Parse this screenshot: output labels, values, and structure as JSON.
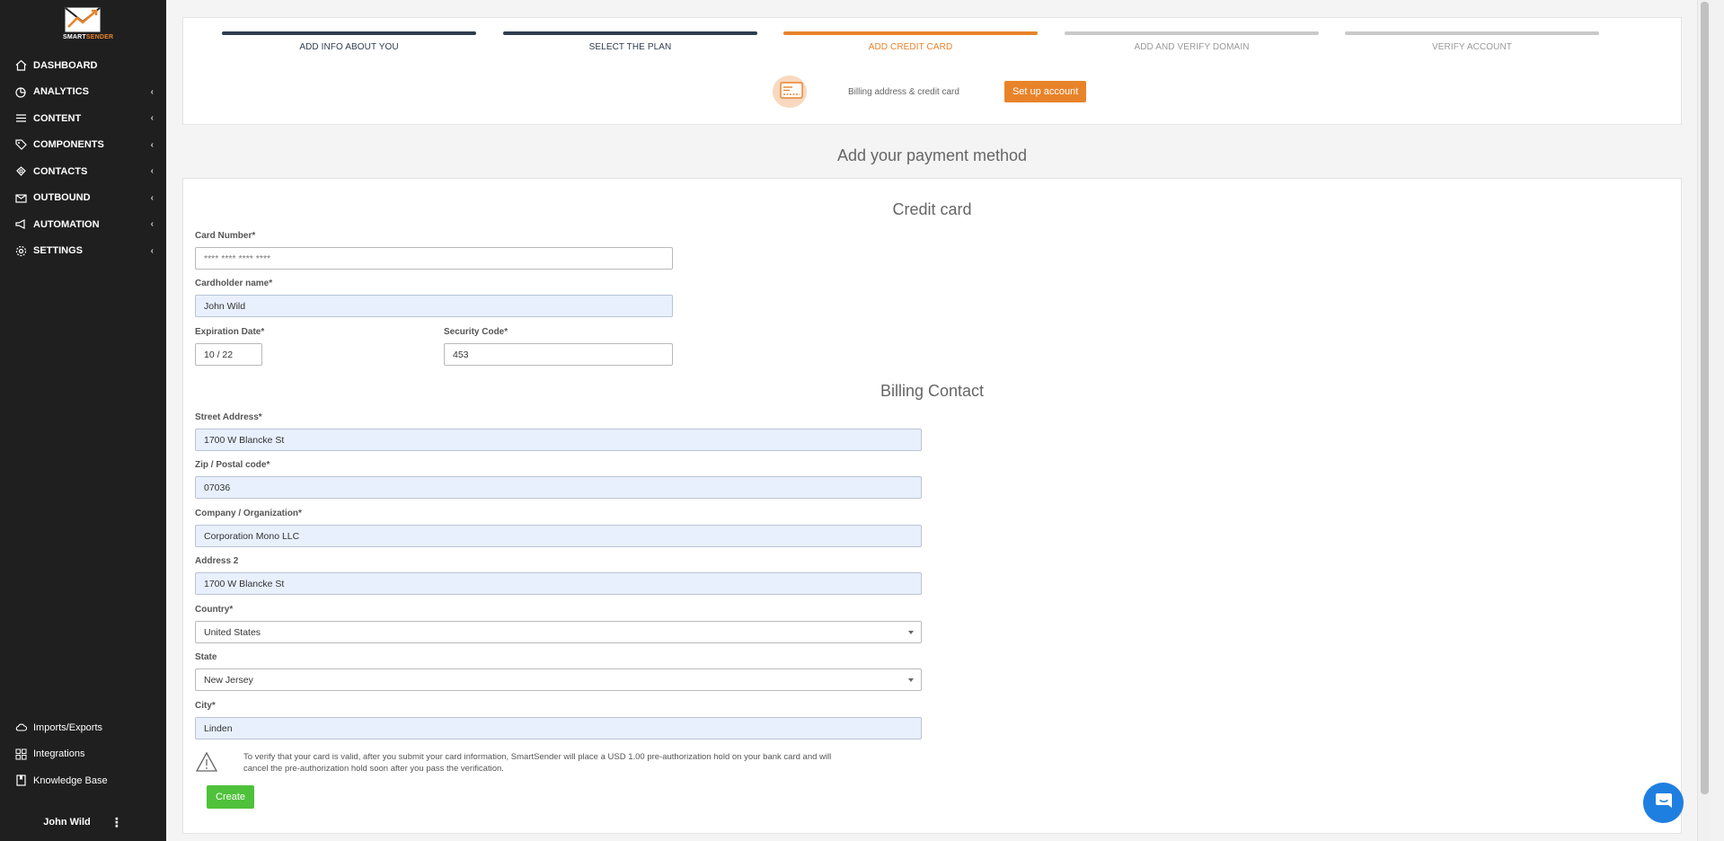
{
  "brand": {
    "name_part1": "SMART",
    "name_part2": "SENDER",
    "accent_color": "#e8832a"
  },
  "sidebar": {
    "items": [
      {
        "label": "DASHBOARD",
        "icon": "home-icon",
        "has_submenu": false
      },
      {
        "label": "ANALYTICS",
        "icon": "analytics-icon",
        "has_submenu": true
      },
      {
        "label": "CONTENT",
        "icon": "content-icon",
        "has_submenu": true
      },
      {
        "label": "COMPONENTS",
        "icon": "tag-icon",
        "has_submenu": true
      },
      {
        "label": "CONTACTS",
        "icon": "contacts-icon",
        "has_submenu": true
      },
      {
        "label": "OUTBOUND",
        "icon": "outbound-icon",
        "has_submenu": true
      },
      {
        "label": "AUTOMATION",
        "icon": "megaphone-icon",
        "has_submenu": true
      },
      {
        "label": "SETTINGS",
        "icon": "gear-icon",
        "has_submenu": true
      }
    ],
    "bottom_items": [
      {
        "label": "Imports/Exports",
        "icon": "cloud-icon"
      },
      {
        "label": "Integrations",
        "icon": "grid-icon"
      },
      {
        "label": "Knowledge Base",
        "icon": "book-icon"
      }
    ],
    "user_name": "John Wild",
    "chevron": "‹",
    "more": "⋮"
  },
  "steps": [
    {
      "label": "ADD INFO ABOUT YOU",
      "state": "done"
    },
    {
      "label": "SELECT THE PLAN",
      "state": "done"
    },
    {
      "label": "ADD CREDIT CARD",
      "state": "active"
    },
    {
      "label": "ADD AND VERIFY DOMAIN",
      "state": "pending"
    },
    {
      "label": "VERIFY ACCOUNT",
      "state": "pending"
    }
  ],
  "step_detail": {
    "description": "Billing address & credit card",
    "button_label": "Set up account"
  },
  "page_heading": "Add your payment method",
  "credit_card": {
    "title": "Credit card",
    "card_number_label": "Card Number*",
    "card_number_placeholder": "**** **** **** ****",
    "cardholder_label": "Cardholder name*",
    "cardholder_value": "John Wild",
    "expiration_label": "Expiration Date*",
    "expiration_value": "10 / 22",
    "security_label": "Security Code*",
    "security_value": "453"
  },
  "billing": {
    "title": "Billing Contact",
    "street_label": "Street Address*",
    "street_value": "1700 W Blancke St",
    "zip_label": "Zip / Postal code*",
    "zip_value": "07036",
    "company_label": "Company / Organization*",
    "company_value": "Corporation Mono LLC",
    "address2_label": "Address 2",
    "address2_value": "1700 W Blancke St",
    "country_label": "Country*",
    "country_value": "United States",
    "state_label": "State",
    "state_value": "New Jersey",
    "city_label": "City*",
    "city_value": "Linden"
  },
  "notice_text": "To verify that your card is valid, after you submit your card information, SmartSender will place a USD 1.00 pre-authorization hold on your bank card and will cancel the pre-authorization hold soon after you pass the verification.",
  "create_label": "Create",
  "colors": {
    "sidebar_bg": "#1f1f1f",
    "step_done": "#2f3d4f",
    "step_active": "#e8832a",
    "step_pending": "#c9c9c9",
    "create_button": "#4fc13a",
    "chat_button": "#1f7fe0"
  }
}
